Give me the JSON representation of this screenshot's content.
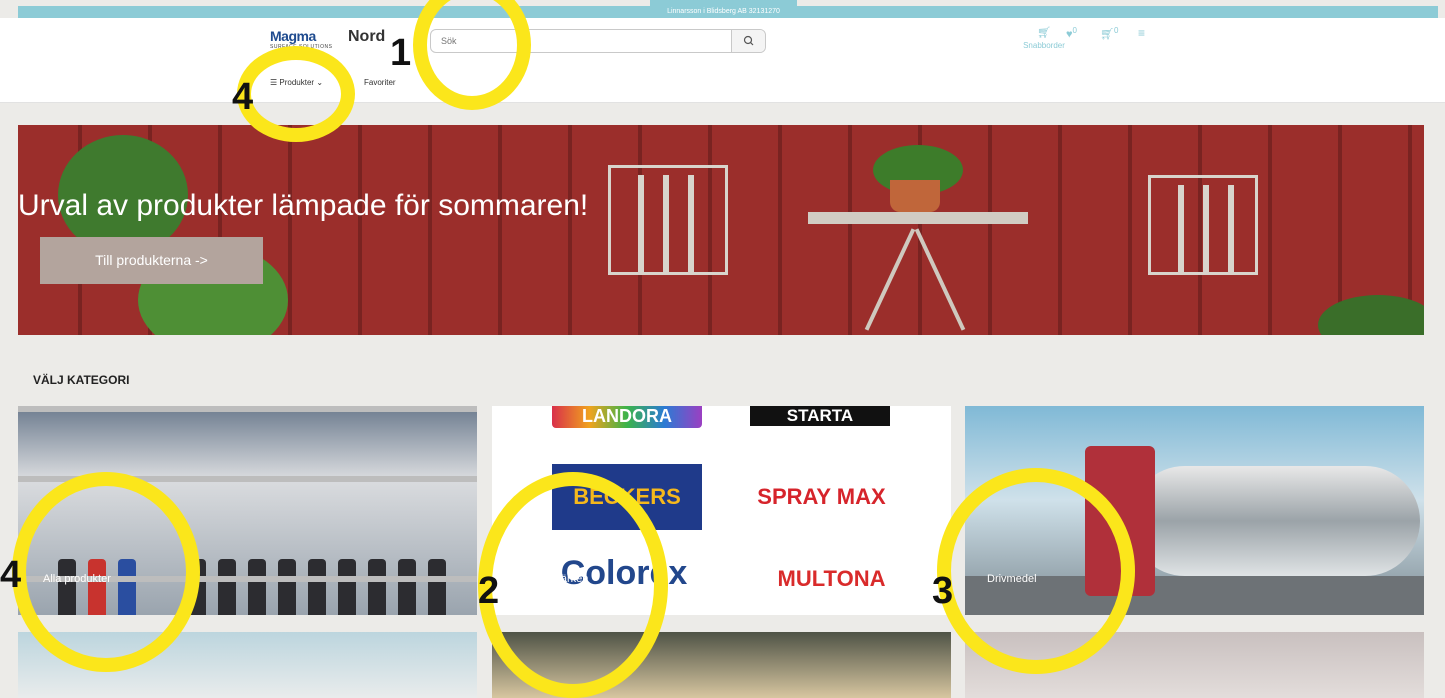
{
  "account_tab": "Linnarsson i Blidsberg AB 32131270",
  "logo": {
    "name_part1": "Magma",
    "name_part2": "Nord",
    "tagline": "SURFACE SOLUTIONS"
  },
  "search": {
    "placeholder": "Sök",
    "button_icon": "search-icon"
  },
  "header_icons": {
    "quick_order_label": "Snabborder",
    "favorites_count": "0",
    "cart_count": "0",
    "menu_icon": "hamburger-icon"
  },
  "nav": {
    "products_label": "Produkter",
    "favorites_label": "Favoriter"
  },
  "hero": {
    "title": "Urval av produkter lämpade för sommaren!",
    "button_label": "Till produkterna ->"
  },
  "categories": {
    "section_title": "VÄLJ KATEGORI",
    "items": [
      {
        "label": "Alla produkter"
      },
      {
        "label": "Våra varumärken"
      },
      {
        "label": "Drivmedel"
      }
    ],
    "brands": [
      "LANDORA",
      "STARTA",
      "BECKERS",
      "SPRAY MAX",
      "Colorex",
      "MULTONA"
    ]
  },
  "annotations": {
    "n1": "1",
    "n2": "2",
    "n3": "3",
    "n4": "4",
    "n4b": "4"
  },
  "colors": {
    "accent": "#8ccbd6",
    "annotation": "#fbe61b",
    "hero_button": "#b3a49d",
    "background": "#ecebe8"
  }
}
